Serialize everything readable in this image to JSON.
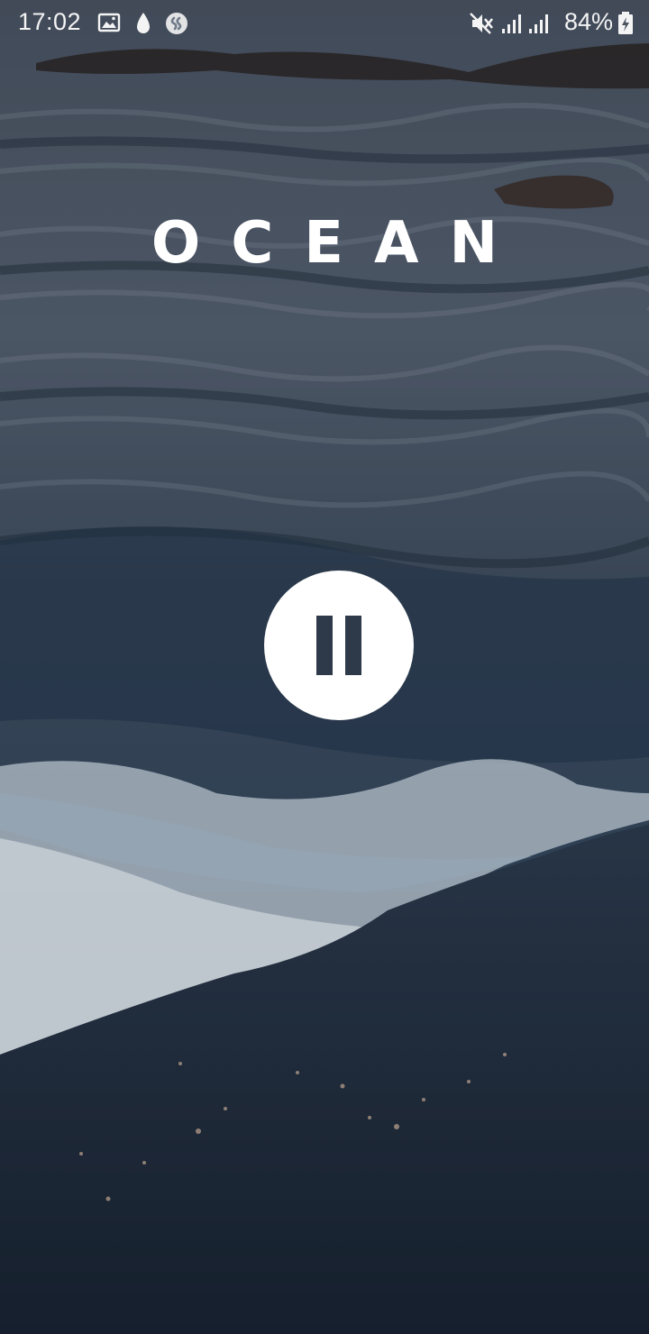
{
  "status_bar": {
    "time": "17:02",
    "battery_percent": "84%",
    "icons": [
      "gallery-icon",
      "water-drop-icon",
      "shazam-icon",
      "mute-icon",
      "signal-icon",
      "signal-icon",
      "battery-charging-icon"
    ]
  },
  "screen": {
    "title": "OCEAN",
    "pause_button": {
      "icon": "pause-icon",
      "state": "playing"
    }
  },
  "colors": {
    "title": "#ffffff",
    "button_bg": "#ffffff",
    "button_icon": "#2e3a4a",
    "water_dark": "#1c2633"
  }
}
